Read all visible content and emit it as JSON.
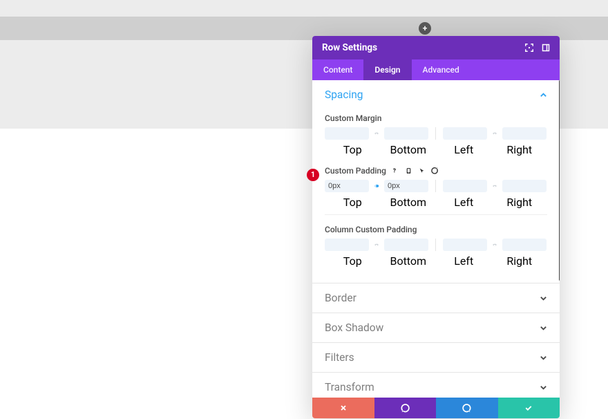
{
  "modal": {
    "title": "Row Settings",
    "tabs": {
      "content": "Content",
      "design": "Design",
      "advanced": "Advanced"
    },
    "active_tab": "Design",
    "sections": {
      "spacing": {
        "label": "Spacing",
        "custom_margin": {
          "label": "Custom Margin",
          "top": {
            "label": "Top",
            "value": ""
          },
          "bottom": {
            "label": "Bottom",
            "value": ""
          },
          "left": {
            "label": "Left",
            "value": ""
          },
          "right": {
            "label": "Right",
            "value": ""
          }
        },
        "custom_padding": {
          "label": "Custom Padding",
          "top": {
            "label": "Top",
            "value": "0px"
          },
          "bottom": {
            "label": "Bottom",
            "value": "0px"
          },
          "left": {
            "label": "Left",
            "value": ""
          },
          "right": {
            "label": "Right",
            "value": ""
          }
        },
        "column_custom_padding": {
          "label": "Column Custom Padding",
          "top": {
            "label": "Top",
            "value": ""
          },
          "bottom": {
            "label": "Bottom",
            "value": ""
          },
          "left": {
            "label": "Left",
            "value": ""
          },
          "right": {
            "label": "Right",
            "value": ""
          }
        }
      },
      "border": {
        "label": "Border"
      },
      "box_shadow": {
        "label": "Box Shadow"
      },
      "filters": {
        "label": "Filters"
      },
      "transform": {
        "label": "Transform"
      }
    }
  },
  "annotation": {
    "num": "1"
  }
}
